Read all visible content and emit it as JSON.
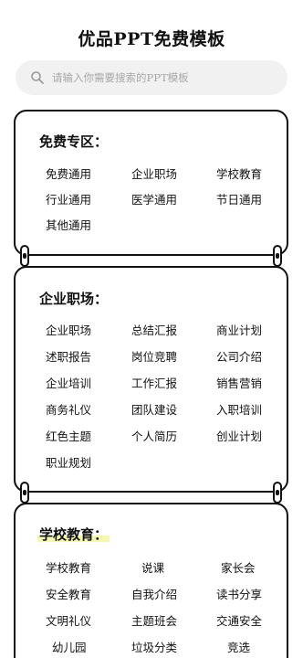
{
  "title": "优品PPT免费模板",
  "search": {
    "placeholder": "请输入你需要搜索的PPT模板"
  },
  "sections": [
    {
      "heading": "免费专区：",
      "items": [
        "免费通用",
        "企业职场",
        "学校教育",
        "行业通用",
        "医学通用",
        "节日通用",
        "其他通用"
      ]
    },
    {
      "heading": "企业职场：",
      "items": [
        "企业职场",
        "总结汇报",
        "商业计划",
        "述职报告",
        "岗位竞聘",
        "公司介绍",
        "企业培训",
        "工作汇报",
        "销售营销",
        "商务礼仪",
        "团队建设",
        "入职培训",
        "红色主题",
        "个人简历",
        "创业计划",
        "职业规划"
      ]
    },
    {
      "heading": "学校教育：",
      "items": [
        "学校教育",
        "说课",
        "家长会",
        "安全教育",
        "自我介绍",
        "读书分享",
        "文明礼仪",
        "主题班会",
        "交通安全",
        "幼儿园",
        "垃圾分类",
        "竞选"
      ]
    }
  ]
}
